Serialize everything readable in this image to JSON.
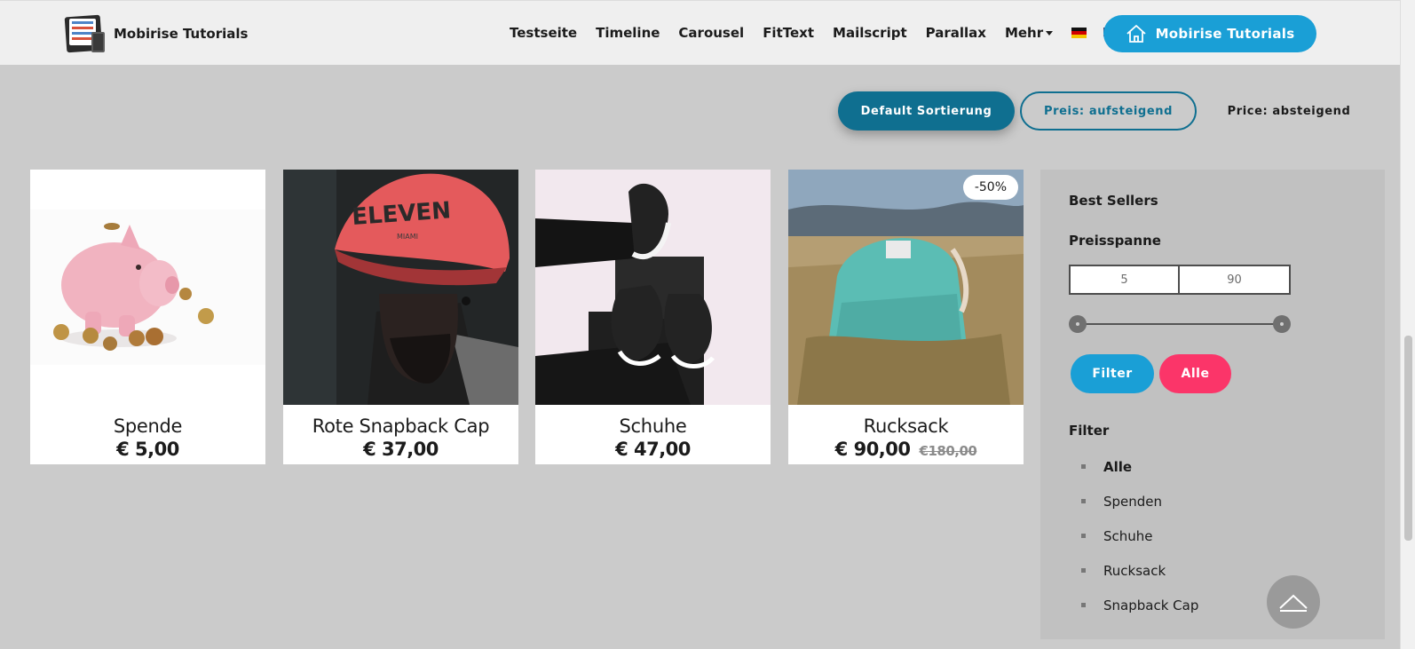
{
  "brand": {
    "name": "Mobirise Tutorials"
  },
  "nav": {
    "items": [
      "Testseite",
      "Timeline",
      "Carousel",
      "FitText",
      "Mailscript",
      "Parallax",
      "Mehr"
    ],
    "flags": [
      "german-flag-icon",
      "us-flag-icon"
    ],
    "cta_label": "Mobirise Tutorials"
  },
  "sort": {
    "default_label": "Default Sortierung",
    "asc_label": "Preis: aufsteigend",
    "desc_label": "Price: absteigend"
  },
  "products": [
    {
      "name": "Spende",
      "price": "€ 5,00",
      "image": "piggy-bank-image"
    },
    {
      "name": "Rote Snapback Cap",
      "price": "€ 37,00",
      "image": "snapback-cap-image"
    },
    {
      "name": "Schuhe",
      "price": "€ 47,00",
      "image": "sneakers-image"
    },
    {
      "name": "Rucksack",
      "price": "€ 90,00",
      "old_price": "€180,00",
      "badge": "-50%",
      "image": "backpack-image"
    }
  ],
  "sidebar": {
    "best_sellers": "Best Sellers",
    "price_range_title": "Preisspanne",
    "price_min": "5",
    "price_max": "90",
    "slider_min_fraction": 0,
    "slider_max_fraction": 1,
    "filter_button": "Filter",
    "alle_button": "Alle",
    "filter_title": "Filter",
    "categories": [
      "Alle",
      "Spenden",
      "Schuhe",
      "Rucksack",
      "Snapback Cap"
    ],
    "active_category": "Alle"
  },
  "colors": {
    "accent_blue": "#1a9fd6",
    "sort_active": "#0f6f90",
    "accent_pink": "#fb3569",
    "page_bg": "#cbcbcb"
  }
}
